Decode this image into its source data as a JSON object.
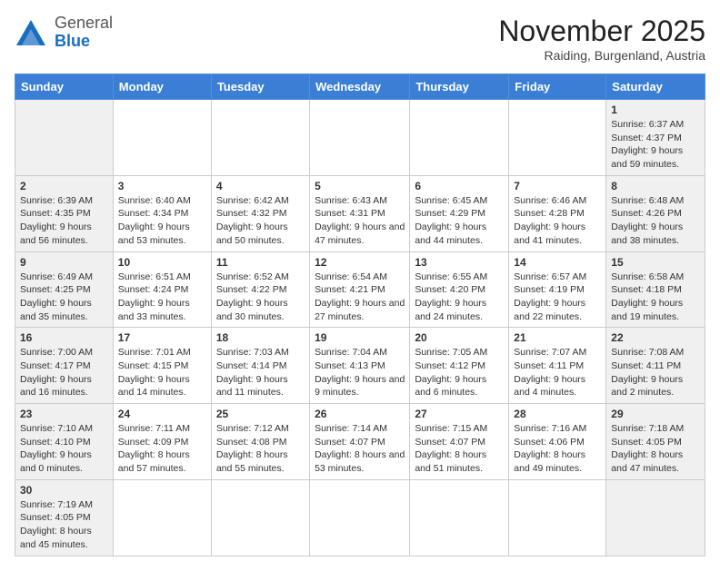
{
  "header": {
    "logo_general": "General",
    "logo_blue": "Blue",
    "month_title": "November 2025",
    "subtitle": "Raiding, Burgenland, Austria"
  },
  "weekdays": [
    "Sunday",
    "Monday",
    "Tuesday",
    "Wednesday",
    "Thursday",
    "Friday",
    "Saturday"
  ],
  "weeks": [
    [
      {
        "day": "",
        "info": ""
      },
      {
        "day": "",
        "info": ""
      },
      {
        "day": "",
        "info": ""
      },
      {
        "day": "",
        "info": ""
      },
      {
        "day": "",
        "info": ""
      },
      {
        "day": "",
        "info": ""
      },
      {
        "day": "1",
        "info": "Sunrise: 6:37 AM\nSunset: 4:37 PM\nDaylight: 9 hours and 59 minutes."
      }
    ],
    [
      {
        "day": "2",
        "info": "Sunrise: 6:39 AM\nSunset: 4:35 PM\nDaylight: 9 hours and 56 minutes."
      },
      {
        "day": "3",
        "info": "Sunrise: 6:40 AM\nSunset: 4:34 PM\nDaylight: 9 hours and 53 minutes."
      },
      {
        "day": "4",
        "info": "Sunrise: 6:42 AM\nSunset: 4:32 PM\nDaylight: 9 hours and 50 minutes."
      },
      {
        "day": "5",
        "info": "Sunrise: 6:43 AM\nSunset: 4:31 PM\nDaylight: 9 hours and 47 minutes."
      },
      {
        "day": "6",
        "info": "Sunrise: 6:45 AM\nSunset: 4:29 PM\nDaylight: 9 hours and 44 minutes."
      },
      {
        "day": "7",
        "info": "Sunrise: 6:46 AM\nSunset: 4:28 PM\nDaylight: 9 hours and 41 minutes."
      },
      {
        "day": "8",
        "info": "Sunrise: 6:48 AM\nSunset: 4:26 PM\nDaylight: 9 hours and 38 minutes."
      }
    ],
    [
      {
        "day": "9",
        "info": "Sunrise: 6:49 AM\nSunset: 4:25 PM\nDaylight: 9 hours and 35 minutes."
      },
      {
        "day": "10",
        "info": "Sunrise: 6:51 AM\nSunset: 4:24 PM\nDaylight: 9 hours and 33 minutes."
      },
      {
        "day": "11",
        "info": "Sunrise: 6:52 AM\nSunset: 4:22 PM\nDaylight: 9 hours and 30 minutes."
      },
      {
        "day": "12",
        "info": "Sunrise: 6:54 AM\nSunset: 4:21 PM\nDaylight: 9 hours and 27 minutes."
      },
      {
        "day": "13",
        "info": "Sunrise: 6:55 AM\nSunset: 4:20 PM\nDaylight: 9 hours and 24 minutes."
      },
      {
        "day": "14",
        "info": "Sunrise: 6:57 AM\nSunset: 4:19 PM\nDaylight: 9 hours and 22 minutes."
      },
      {
        "day": "15",
        "info": "Sunrise: 6:58 AM\nSunset: 4:18 PM\nDaylight: 9 hours and 19 minutes."
      }
    ],
    [
      {
        "day": "16",
        "info": "Sunrise: 7:00 AM\nSunset: 4:17 PM\nDaylight: 9 hours and 16 minutes."
      },
      {
        "day": "17",
        "info": "Sunrise: 7:01 AM\nSunset: 4:15 PM\nDaylight: 9 hours and 14 minutes."
      },
      {
        "day": "18",
        "info": "Sunrise: 7:03 AM\nSunset: 4:14 PM\nDaylight: 9 hours and 11 minutes."
      },
      {
        "day": "19",
        "info": "Sunrise: 7:04 AM\nSunset: 4:13 PM\nDaylight: 9 hours and 9 minutes."
      },
      {
        "day": "20",
        "info": "Sunrise: 7:05 AM\nSunset: 4:12 PM\nDaylight: 9 hours and 6 minutes."
      },
      {
        "day": "21",
        "info": "Sunrise: 7:07 AM\nSunset: 4:11 PM\nDaylight: 9 hours and 4 minutes."
      },
      {
        "day": "22",
        "info": "Sunrise: 7:08 AM\nSunset: 4:11 PM\nDaylight: 9 hours and 2 minutes."
      }
    ],
    [
      {
        "day": "23",
        "info": "Sunrise: 7:10 AM\nSunset: 4:10 PM\nDaylight: 9 hours and 0 minutes."
      },
      {
        "day": "24",
        "info": "Sunrise: 7:11 AM\nSunset: 4:09 PM\nDaylight: 8 hours and 57 minutes."
      },
      {
        "day": "25",
        "info": "Sunrise: 7:12 AM\nSunset: 4:08 PM\nDaylight: 8 hours and 55 minutes."
      },
      {
        "day": "26",
        "info": "Sunrise: 7:14 AM\nSunset: 4:07 PM\nDaylight: 8 hours and 53 minutes."
      },
      {
        "day": "27",
        "info": "Sunrise: 7:15 AM\nSunset: 4:07 PM\nDaylight: 8 hours and 51 minutes."
      },
      {
        "day": "28",
        "info": "Sunrise: 7:16 AM\nSunset: 4:06 PM\nDaylight: 8 hours and 49 minutes."
      },
      {
        "day": "29",
        "info": "Sunrise: 7:18 AM\nSunset: 4:05 PM\nDaylight: 8 hours and 47 minutes."
      }
    ],
    [
      {
        "day": "30",
        "info": "Sunrise: 7:19 AM\nSunset: 4:05 PM\nDaylight: 8 hours and 45 minutes."
      },
      {
        "day": "",
        "info": ""
      },
      {
        "day": "",
        "info": ""
      },
      {
        "day": "",
        "info": ""
      },
      {
        "day": "",
        "info": ""
      },
      {
        "day": "",
        "info": ""
      },
      {
        "day": "",
        "info": ""
      }
    ]
  ]
}
